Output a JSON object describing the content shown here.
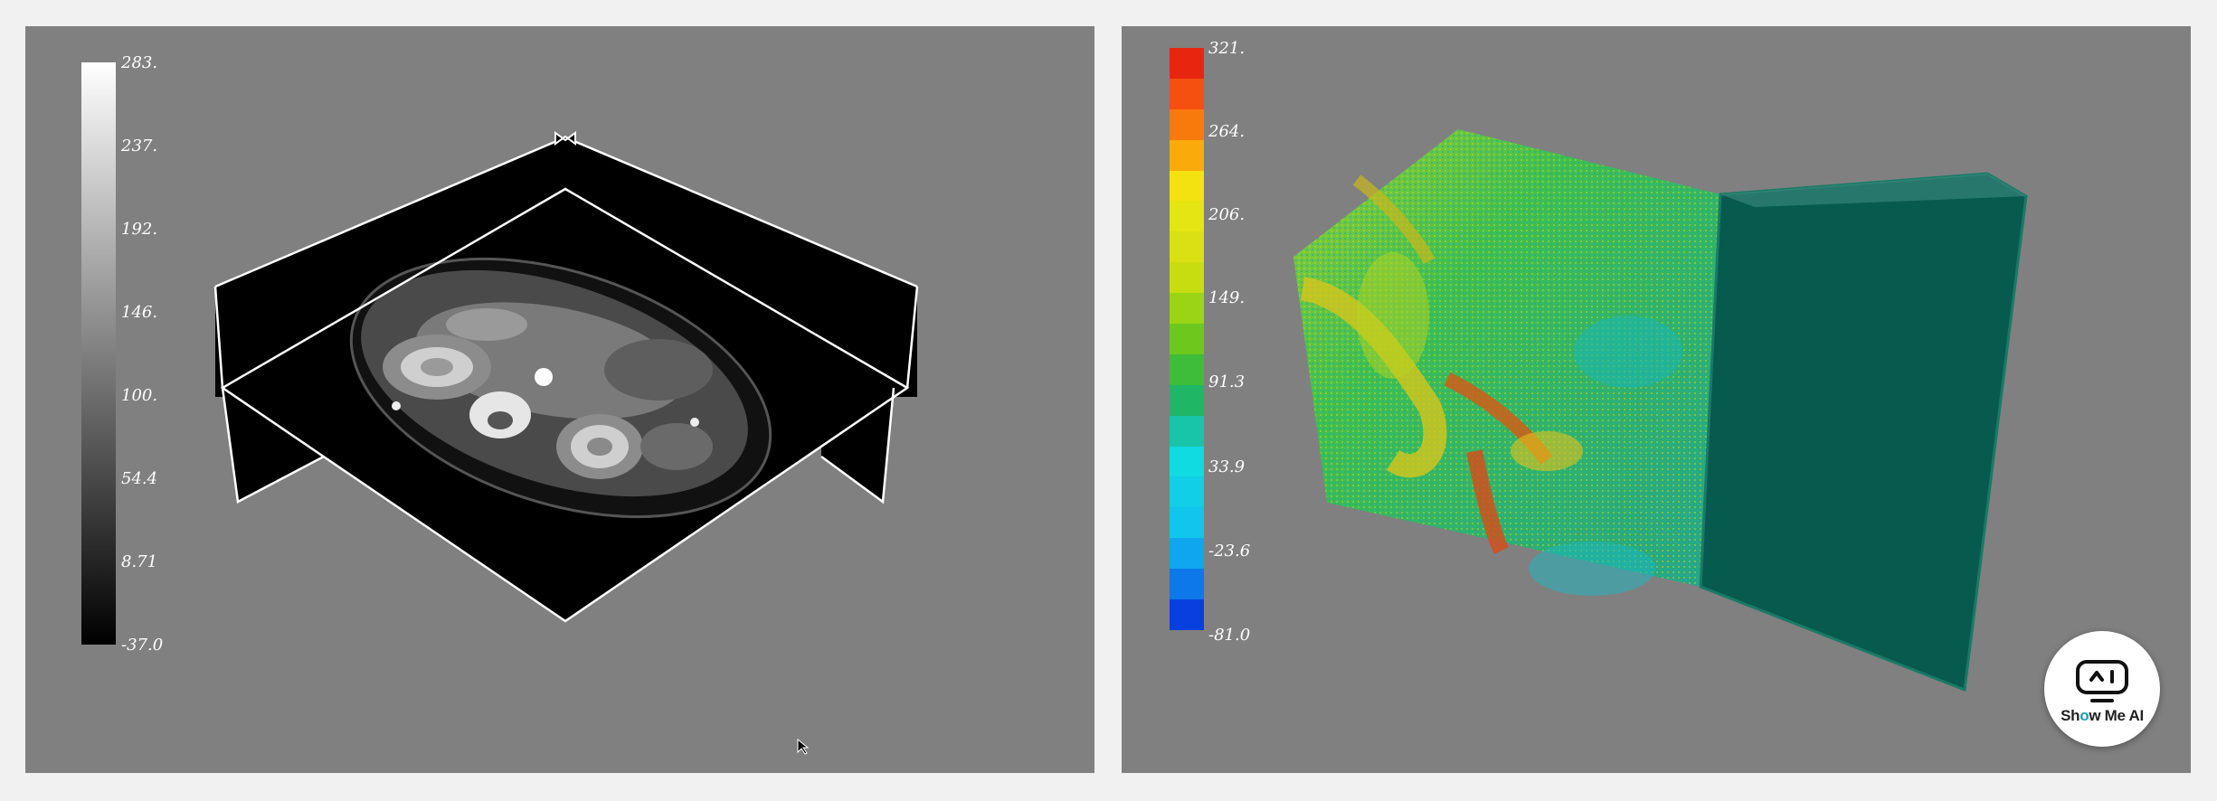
{
  "left_viewer": {
    "colorbar_labels": [
      "283.",
      "237.",
      "192.",
      "146.",
      "100.",
      "54.4",
      "8.71",
      "-37.0"
    ],
    "colormap": "grayscale",
    "colors": {
      "background": "#808080",
      "bar_top": "#ffffff",
      "bar_bottom": "#000000",
      "outline": "#ffffff"
    }
  },
  "right_viewer": {
    "colorbar_labels": [
      "321.",
      "264.",
      "206.",
      "149.",
      "91.3",
      "33.9",
      "-23.6",
      "-81.0"
    ],
    "colormap": "jet",
    "colors": {
      "background": "#808080",
      "volume_face": "#075a4e"
    }
  },
  "badge": {
    "icon": "robot-face-icon",
    "text_prefix": "Sh",
    "text_o": "o",
    "text_suffix": "w Me AI",
    "accent": "#17a2b8"
  }
}
